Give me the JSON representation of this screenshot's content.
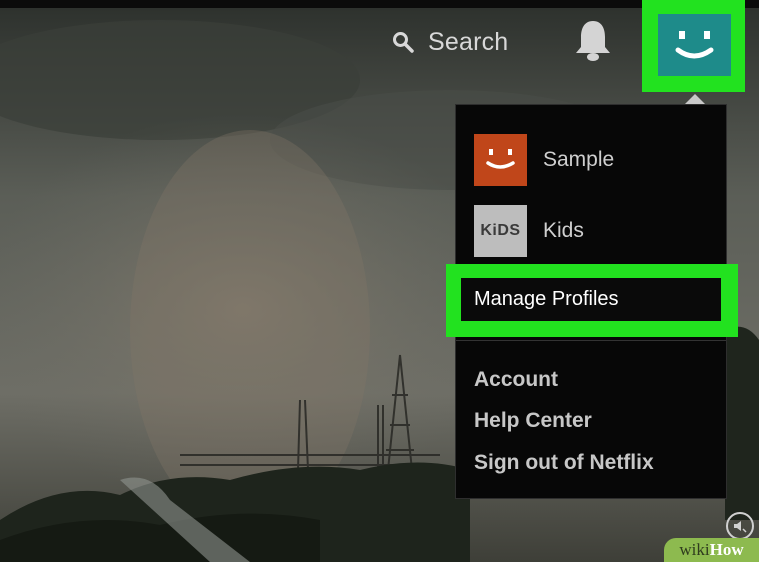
{
  "header": {
    "search_label": "Search"
  },
  "menu": {
    "profiles": [
      {
        "name": "Sample",
        "avatar_color": "#c0461a"
      },
      {
        "name": "Kids",
        "avatar_label": "KiDS",
        "avatar_color": "#bdbdbd"
      }
    ],
    "manage_profiles": "Manage Profiles",
    "links": [
      "Account",
      "Help Center",
      "Sign out of Netflix"
    ]
  },
  "colors": {
    "highlight": "#22e21f",
    "current_avatar": "#1e8b8a",
    "menu_bg": "#070707"
  },
  "watermark": {
    "wiki": "wiki",
    "how": "How"
  }
}
